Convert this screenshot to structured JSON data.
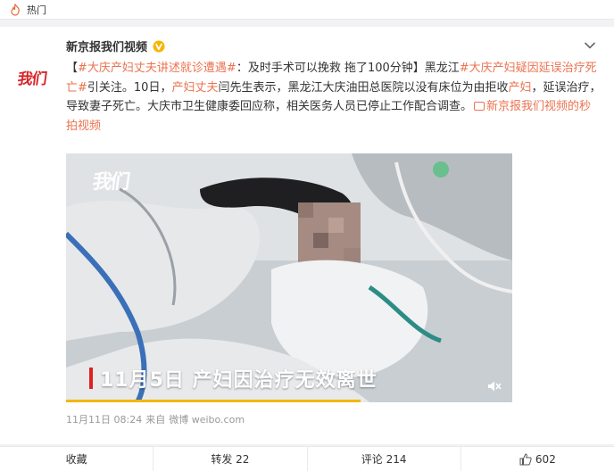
{
  "hot_bar": {
    "label": "热门",
    "icon": "hot-flame-icon"
  },
  "post": {
    "avatar_logo": "我们",
    "author": "新京报我们视频",
    "verified_icon": "verified-v-icon",
    "menu_icon": "chevron-down-icon",
    "text": {
      "seg1": "【",
      "topic1": "#大庆产妇丈夫讲述就诊遭遇#",
      "seg2": "：及时手术可以挽救 拖了100分钟】黑龙江",
      "topic2": "#大庆产妇疑因延误治疗死亡#",
      "seg3": "引关注。10日，",
      "kw1": "产妇丈夫",
      "seg4": "闫先生表示，黑龙江大庆油田总医院以没有床位为由拒收",
      "kw2": "产妇",
      "seg5": "，延误治疗，导致妻子死亡。大庆市卫生健康委回应称，相关医务人员已停止工作配合调查。",
      "video_link": "新京报我们视频的秒拍视频"
    },
    "video": {
      "watermark": "我们",
      "subtitle": "11月5日 产妇因治疗无效离世",
      "mute_icon": "mute-icon",
      "progress_fraction": 0.66
    },
    "meta": {
      "time": "11月11日 08:24",
      "source_prefix": "来自",
      "source": "微博 weibo.com"
    }
  },
  "actions": [
    {
      "name": "favorite",
      "label": "收藏",
      "icon": ""
    },
    {
      "name": "repost",
      "label": "转发 22",
      "icon": ""
    },
    {
      "name": "comment",
      "label": "评论 214",
      "icon": ""
    },
    {
      "name": "like",
      "label": "602",
      "icon": "thumbs-up-icon"
    }
  ],
  "colors": {
    "accent": "#eb7350",
    "brand_red": "#d7262a",
    "verified": "#f7b500",
    "progress": "#f5b700"
  }
}
